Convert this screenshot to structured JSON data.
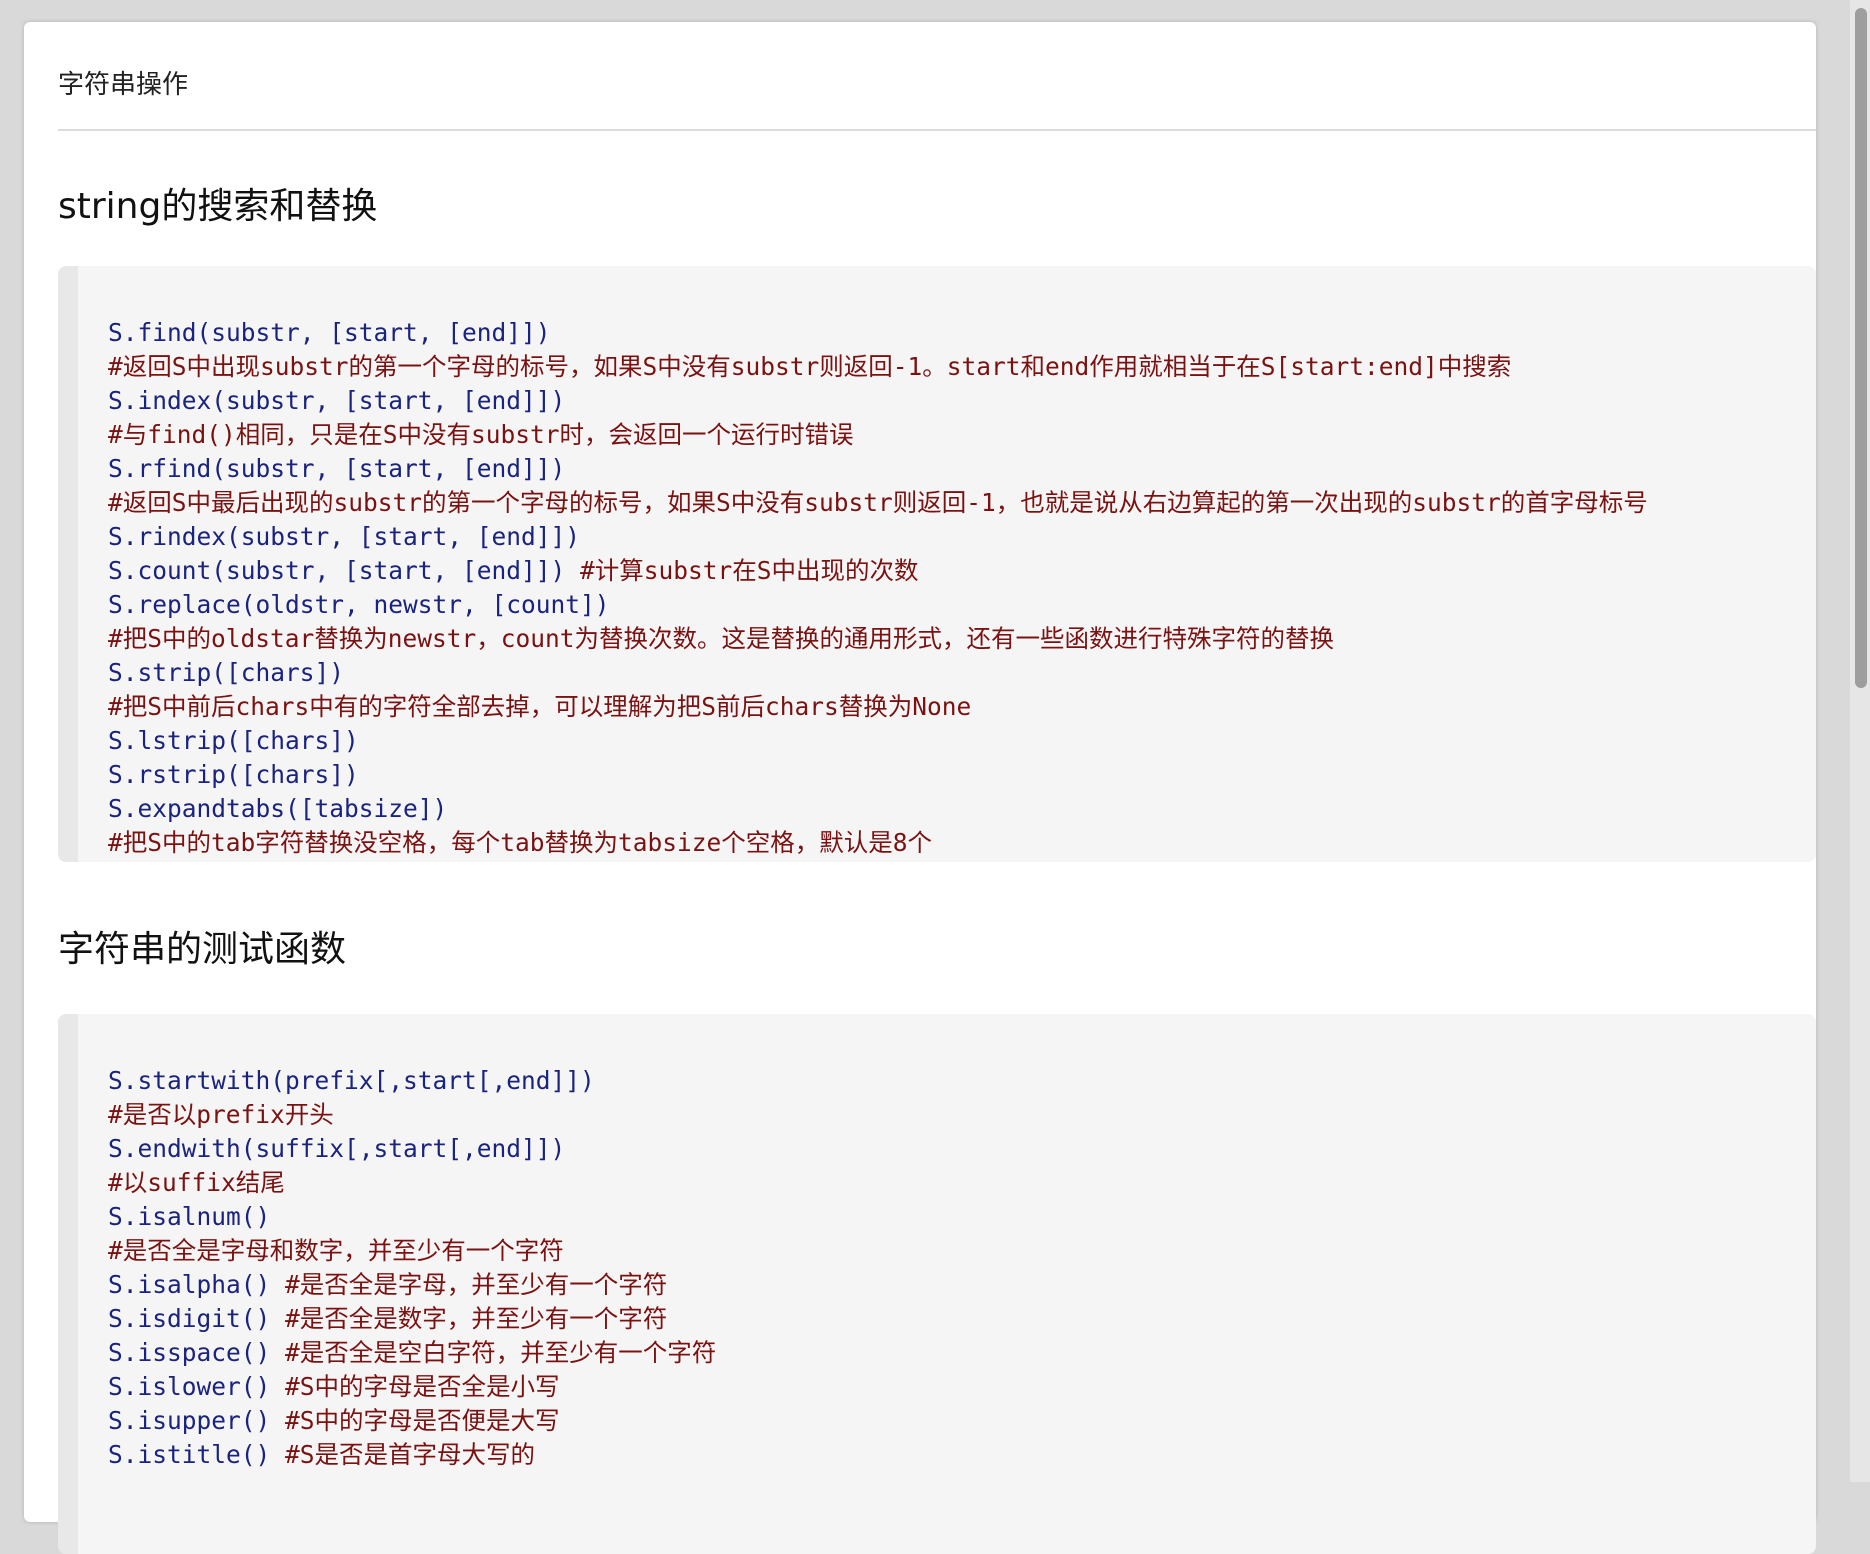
{
  "page": {
    "title": "字符串操作"
  },
  "sections": [
    {
      "heading": "string的搜索和替换",
      "lines": [
        {
          "code": "S.find(substr, [start, [end]])",
          "comment": ""
        },
        {
          "code": "",
          "comment": "#返回S中出现substr的第一个字母的标号，如果S中没有substr则返回-1。start和end作用就相当于在S[start:end]中搜索"
        },
        {
          "code": "S.index(substr, [start, [end]])",
          "comment": ""
        },
        {
          "code": "",
          "comment": "#与find()相同，只是在S中没有substr时，会返回一个运行时错误"
        },
        {
          "code": "S.rfind(substr, [start, [end]])",
          "comment": ""
        },
        {
          "code": "",
          "comment": "#返回S中最后出现的substr的第一个字母的标号，如果S中没有substr则返回-1，也就是说从右边算起的第一次出现的substr的首字母标号"
        },
        {
          "code": "S.rindex(substr, [start, [end]])",
          "comment": ""
        },
        {
          "code": "S.count(substr, [start, [end]]) ",
          "comment": "#计算substr在S中出现的次数"
        },
        {
          "code": "S.replace(oldstr, newstr, [count])",
          "comment": ""
        },
        {
          "code": "",
          "comment": "#把S中的oldstar替换为newstr，count为替换次数。这是替换的通用形式，还有一些函数进行特殊字符的替换"
        },
        {
          "code": "S.strip([chars])",
          "comment": ""
        },
        {
          "code": "",
          "comment": "#把S中前后chars中有的字符全部去掉，可以理解为把S前后chars替换为None"
        },
        {
          "code": "S.lstrip([chars])",
          "comment": ""
        },
        {
          "code": "S.rstrip([chars])",
          "comment": ""
        },
        {
          "code": "S.expandtabs([tabsize])",
          "comment": ""
        },
        {
          "code": "",
          "comment": "#把S中的tab字符替换没空格，每个tab替换为tabsize个空格，默认是8个"
        }
      ]
    },
    {
      "heading": "字符串的测试函数",
      "lines": [
        {
          "code": "S.startwith(prefix[,start[,end]])",
          "comment": ""
        },
        {
          "code": "",
          "comment": "#是否以prefix开头"
        },
        {
          "code": "S.endwith(suffix[,start[,end]])",
          "comment": ""
        },
        {
          "code": "",
          "comment": "#以suffix结尾"
        },
        {
          "code": "S.isalnum()",
          "comment": ""
        },
        {
          "code": "",
          "comment": "#是否全是字母和数字，并至少有一个字符"
        },
        {
          "code": "S.isalpha() ",
          "comment": "#是否全是字母，并至少有一个字符"
        },
        {
          "code": "S.isdigit() ",
          "comment": "#是否全是数字，并至少有一个字符"
        },
        {
          "code": "S.isspace() ",
          "comment": "#是否全是空白字符，并至少有一个字符"
        },
        {
          "code": "S.islower() ",
          "comment": "#S中的字母是否全是小写"
        },
        {
          "code": "S.isupper() ",
          "comment": "#S中的字母是否便是大写"
        },
        {
          "code": "S.istitle() ",
          "comment": "#S是否是首字母大写的"
        }
      ]
    }
  ],
  "colors": {
    "code": "#1a237e",
    "comment": "#7a1212",
    "code_bg": "#f5f5f5",
    "page_bg": "#d9d9d9"
  }
}
